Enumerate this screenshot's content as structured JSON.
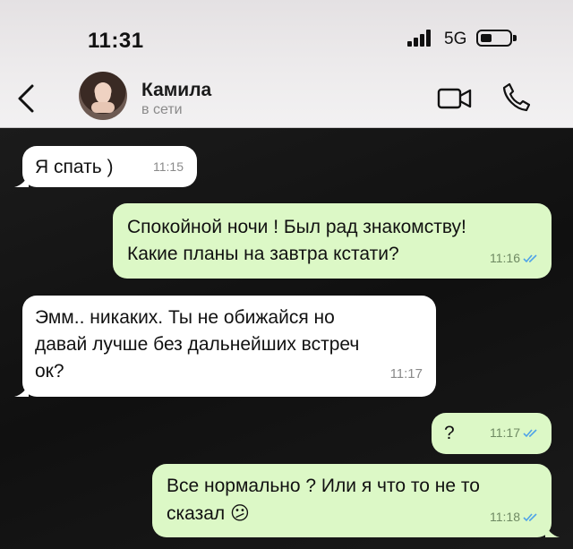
{
  "status_bar": {
    "time": "11:31",
    "network": "5G"
  },
  "header": {
    "contact_name": "Камила",
    "contact_status": "в сети"
  },
  "icons": [
    "back-chevron-icon",
    "video-call-icon",
    "phone-call-icon",
    "double-check-icon"
  ],
  "colors": {
    "incoming": "#ffffff",
    "outgoing": "#dcf8c6",
    "read_ticks": "#4fa3e8",
    "background": "#141414"
  },
  "messages": [
    {
      "direction": "in",
      "text": "Я спать )",
      "time": "11:15"
    },
    {
      "direction": "out",
      "text": "Спокойной ночи ! Был рад знакомству!\nКакие планы на завтра кстати?",
      "time": "11:16",
      "read": true
    },
    {
      "direction": "in",
      "text": "Эмм.. никаких. Ты не обижайся но\nдавай лучше без дальнейших встреч\nок?",
      "time": "11:17"
    },
    {
      "direction": "out",
      "text": "?",
      "time": "11:17",
      "read": true
    },
    {
      "direction": "out",
      "text": "Все нормально ? Или я что то не то\nсказал",
      "emoji": "😕",
      "time": "11:18",
      "read": true
    }
  ]
}
